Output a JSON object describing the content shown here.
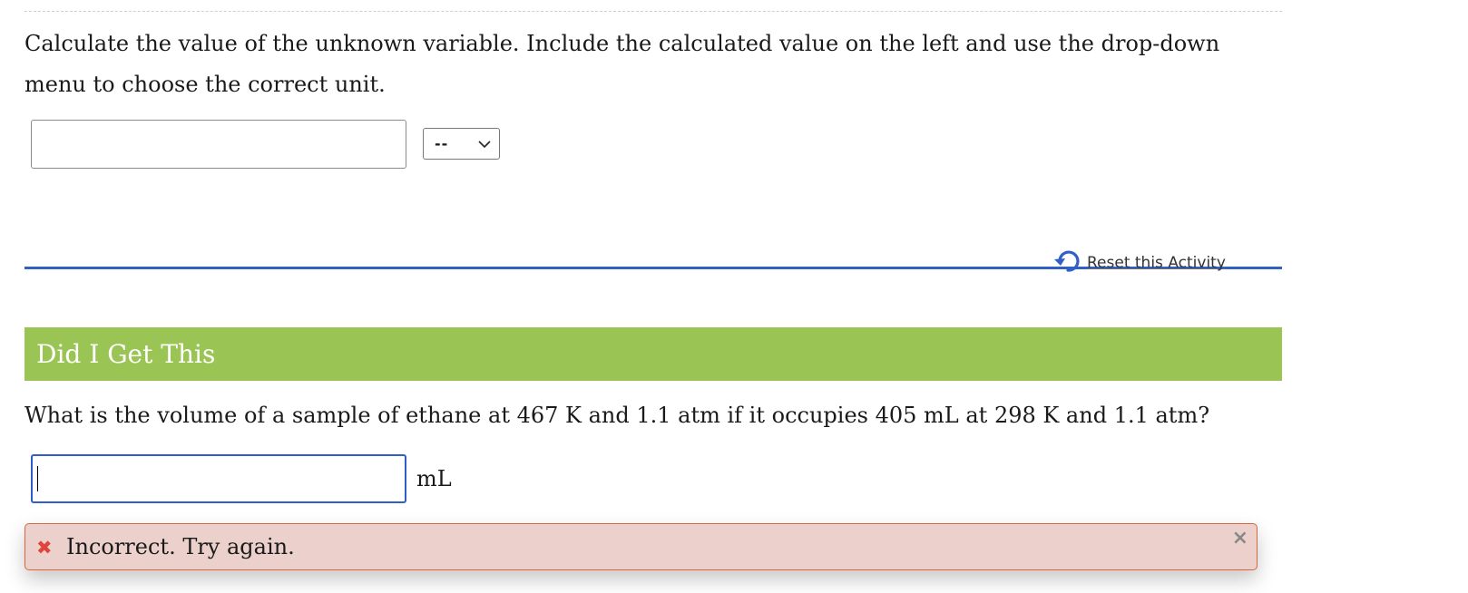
{
  "activity": {
    "instructions": "Calculate the value of the unknown variable. Include the calculated value on the left and use the drop-down menu to choose the correct unit.",
    "answer_value": "",
    "unit_select": {
      "selected": "--"
    },
    "reset_label": "Reset this Activity"
  },
  "section": {
    "title": "Did I Get This"
  },
  "question": {
    "text": "What is the volume of a sample of ethane at 467 K and 1.1 atm if it occupies 405 mL at 298 K and 1.1 atm?",
    "answer_value": "",
    "unit": "mL"
  },
  "feedback": {
    "icon": "x-mark-icon",
    "message": "Incorrect. Try again.",
    "close_icon": "close-icon",
    "colors": {
      "background": "#ecd0cb",
      "border": "#d9663f",
      "icon": "#e0443f"
    }
  },
  "colors": {
    "section_header": "#9ac555",
    "accent_blue": "#2f5fc7"
  }
}
